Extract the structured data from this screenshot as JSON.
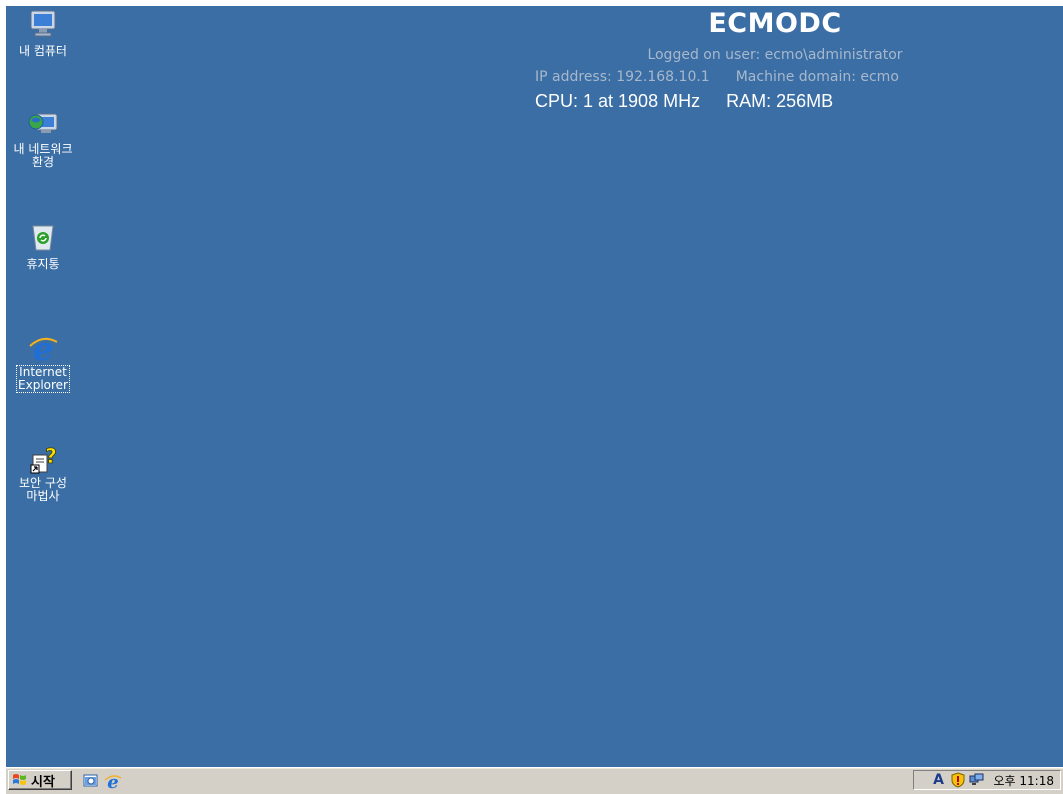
{
  "desktop": {
    "background_color": "#3a6ea5",
    "icons": [
      {
        "name": "my-computer",
        "label": "내 컴퓨터",
        "icon": "computer-icon"
      },
      {
        "name": "network-places",
        "label": "내 네트워크\n환경",
        "icon": "network-icon"
      },
      {
        "name": "recycle-bin",
        "label": "휴지통",
        "icon": "recycle-bin-icon"
      },
      {
        "name": "internet-explorer",
        "label": "Internet\nExplorer",
        "icon": "ie-icon",
        "selected": true
      },
      {
        "name": "security-wizard",
        "label": "보안 구성\n마법사",
        "icon": "security-wizard-icon"
      }
    ]
  },
  "bginfo": {
    "machine_name": "ECMODC",
    "logged_on_user": "Logged on user: ecmo\\administrator",
    "ip_address": "IP address: 192.168.10.1",
    "machine_domain": "Machine domain: ecmo",
    "cpu": "CPU: 1 at 1908 MHz",
    "ram": "RAM: 256MB"
  },
  "taskbar": {
    "start_label": "시작",
    "quick_launch": [
      "show-desktop-icon",
      "ie-icon"
    ],
    "tray_icons": [
      "ime-icon",
      "security-shield-icon",
      "network-connection-icon"
    ],
    "ime_letter": "A",
    "clock": "오후 11:18"
  }
}
